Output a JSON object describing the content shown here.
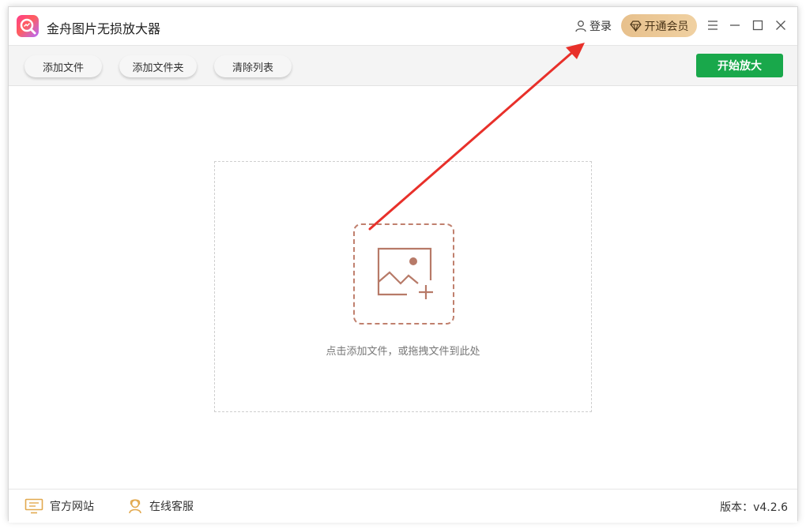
{
  "titlebar": {
    "app_title": "金舟图片无损放大器",
    "login_label": "登录",
    "vip_label": "开通会员",
    "accent_gold": "#e7c08c"
  },
  "toolbar": {
    "add_file": "添加文件",
    "add_folder": "添加文件夹",
    "clear_list": "清除列表",
    "start": "开始放大",
    "start_color": "#19a84b"
  },
  "main": {
    "drop_hint": "点击添加文件，或拖拽文件到此处",
    "icon": "image-add-icon"
  },
  "footer": {
    "website": "官方网站",
    "support": "在线客服",
    "version": "版本：v4.2.6"
  },
  "annotation": {
    "arrow_color": "#e8302a"
  }
}
